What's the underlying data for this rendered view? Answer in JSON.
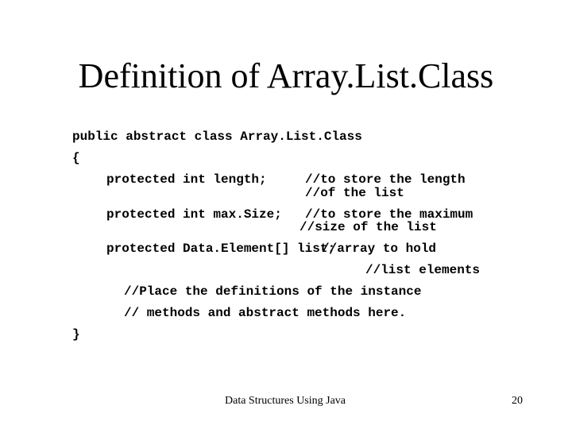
{
  "slide": {
    "title": "Definition of Array.List.Class",
    "code_lines": [
      "public abstract class Array.List.Class",
      "{",
      "protected int length;",
      "//to store the length",
      "//of the list",
      "protected int max.Size;",
      "//to store the maximum",
      "//size of the list",
      "protected Data.Element[] list;",
      "//array to hold",
      "//list elements",
      "//Place the definitions of the instance",
      "// methods and abstract methods here.",
      "}"
    ],
    "footer": {
      "course": "Data Structures Using Java",
      "page_number": "20"
    }
  }
}
